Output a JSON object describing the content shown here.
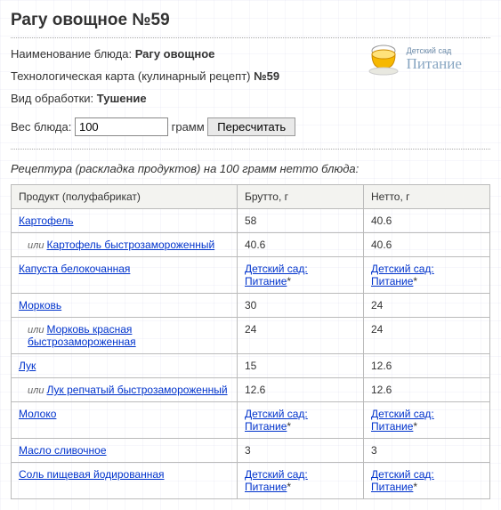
{
  "title": "Рагу овощное №59",
  "logo": {
    "small": "Детский сад",
    "big": "Питание"
  },
  "meta": {
    "name_label": "Наименование блюда: ",
    "name_value": "Рагу овощное",
    "tech_label": "Технологическая карта (кулинарный рецепт) ",
    "tech_value": "№59",
    "proc_label": "Вид обработки: ",
    "proc_value": "Тушение"
  },
  "weight": {
    "label": "Вес блюда: ",
    "value": "100",
    "unit": " грамм ",
    "recalc": "Пересчитать"
  },
  "recipe_note": "Рецептура (раскладка продуктов) на 100 грамм нетто блюда:",
  "columns": {
    "product": "Продукт (полуфабрикат)",
    "brutto": "Брутто, г",
    "netto": "Нетто, г"
  },
  "or_word": "или ",
  "locked_text": "Детский сад: Питание",
  "rows": [
    {
      "name": "Картофель",
      "brutto": "58",
      "netto": "40.6",
      "alt": false,
      "locked": false
    },
    {
      "name": "Картофель быстрозамороженный",
      "brutto": "40.6",
      "netto": "40.6",
      "alt": true,
      "locked": false
    },
    {
      "name": "Капуста белокочанная",
      "brutto": "",
      "netto": "",
      "alt": false,
      "locked": true
    },
    {
      "name": "Морковь",
      "brutto": "30",
      "netto": "24",
      "alt": false,
      "locked": false
    },
    {
      "name": "Морковь красная быстрозамороженная",
      "brutto": "24",
      "netto": "24",
      "alt": true,
      "locked": false
    },
    {
      "name": "Лук",
      "brutto": "15",
      "netto": "12.6",
      "alt": false,
      "locked": false
    },
    {
      "name": "Лук репчатый быстрозамороженный",
      "brutto": "12.6",
      "netto": "12.6",
      "alt": true,
      "locked": false
    },
    {
      "name": "Молоко",
      "brutto": "",
      "netto": "",
      "alt": false,
      "locked": true
    },
    {
      "name": "Масло сливочное",
      "brutto": "3",
      "netto": "3",
      "alt": false,
      "locked": false
    },
    {
      "name": "Соль пищевая йодированная",
      "brutto": "",
      "netto": "",
      "alt": false,
      "locked": true
    }
  ]
}
